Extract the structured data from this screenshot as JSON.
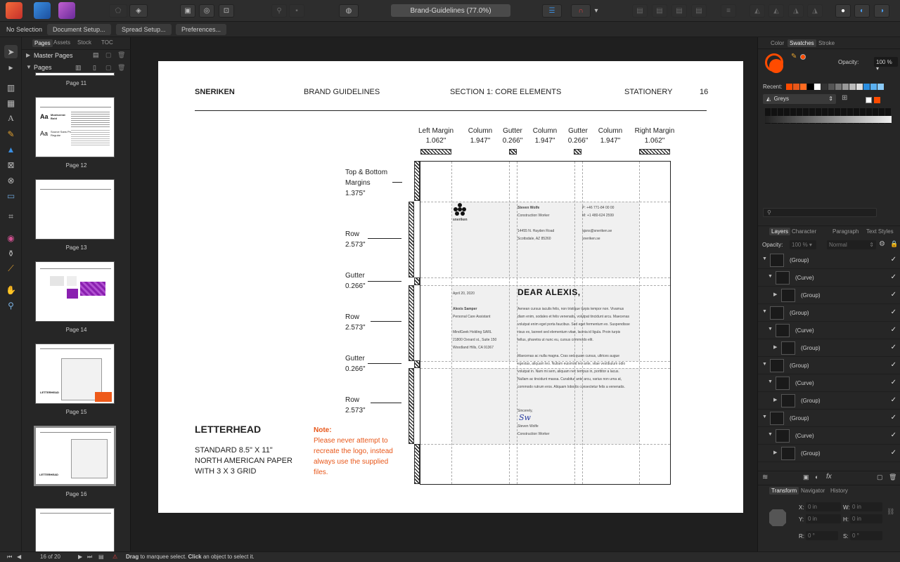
{
  "document": {
    "title": "Brand-Guidelines (77.0%)"
  },
  "context": {
    "selection": "No Selection",
    "document_setup": "Document Setup...",
    "spread_setup": "Spread Setup...",
    "preferences": "Preferences..."
  },
  "pages_panel": {
    "tabs": [
      "Pages",
      "Assets",
      "Stock",
      "TOC"
    ],
    "master_pages": "Master Pages",
    "pages": "Pages",
    "thumbnails": [
      "Page 11",
      "Page 12",
      "Page 13",
      "Page 14",
      "Page 15",
      "Page 16"
    ],
    "page12_font1_name": "Montserrat",
    "page12_font1_weight": "Bold",
    "page12_font2_name": "Source Sans Pro",
    "page12_font2_weight": "Regular",
    "page15_title": "LETTERHEAD",
    "page16_title": "LETTERHEAD"
  },
  "status": {
    "page_counter": "16 of 20",
    "hint_drag": "Drag",
    "hint_mid": " to marquee select. ",
    "hint_click": "Click",
    "hint_end": " an object to select it."
  },
  "page_header": {
    "brand": "SNERIKEN",
    "guide": "BRAND GUIDELINES",
    "section": "SECTION 1: CORE ELEMENTS",
    "topic": "STATIONERY",
    "page_no": "16"
  },
  "margins": [
    {
      "name": "Left Margin",
      "value": "1.062\""
    },
    {
      "name": "Column",
      "value": "1.947\""
    },
    {
      "name": "Gutter",
      "value": "0.266\""
    },
    {
      "name": "Column",
      "value": "1.947\""
    },
    {
      "name": "Gutter",
      "value": "0.266\""
    },
    {
      "name": "Column",
      "value": "1.947\""
    },
    {
      "name": "Right Margin",
      "value": "1.062\""
    }
  ],
  "rows": {
    "tb_l1": "Top & Bottom",
    "tb_l2": "Margins",
    "tb_l3": "1.375\"",
    "row1_name": "Row",
    "row1_val": "2.573\"",
    "gut1_name": "Gutter",
    "gut1_val": "0.266\"",
    "row2_name": "Row",
    "row2_val": "2.573\"",
    "gut2_name": "Gutter",
    "gut2_val": "0.266\"",
    "row3_name": "Row",
    "row3_val": "2.573\""
  },
  "letterhead": {
    "title": "LETTERHEAD",
    "desc1": "STANDARD 8.5\" X 11\"",
    "desc2": "NORTH AMERICAN PAPER",
    "desc3": "WITH 3 X 3 GRID",
    "note_label": "Note:",
    "note1": "Please never attempt to",
    "note2": "recreate the logo, instead",
    "note3": "always use the supplied",
    "note4": "files."
  },
  "letter": {
    "logo_word": "sneriken",
    "sender_name": "Steven Wolfe",
    "sender_role": "Construction Worker",
    "sender_addr1": "14455 N. Hayden Road",
    "sender_addr2": "Scottsdale, AZ 85260",
    "phone": "P:  +46 771-84 00 00",
    "mobile": "M: +1 480-624 2599",
    "email": "ajsns@sneriken.se",
    "web": "sneriken.se",
    "date": "April 20, 2020",
    "to_name": "Alexis Samper",
    "to_role": "Personal Care Assistant",
    "to_co": "MindGeek Holding SARL",
    "to_addr1": "21800 Oxnard st., Suite 150",
    "to_addr2": "Woodland Hills, CA 91367",
    "greeting": "DEAR ALEXIS,",
    "p1_1": "Aenean cursus iaculis felis, non tristique turpis tempor non. Vivamus",
    "p1_2": "diam enim, sodales et felis venenatis, volutpat tincidunt arcu. Maecenas",
    "p1_3": "volutpat enim eget porta faucibus. Sed eget fermentum ex. Suspendisse",
    "p1_4": "risus ex, laoreet sed elementum vitae, lacinia id ligula. Proin turpis",
    "p1_5": "tellus, pharetra ut nunc eu, cursus commodo elit.",
    "p2_1": "Maecenas ac nulla magna. Cras sed quam cursus, ultrices augue",
    "p2_2": "egestas, aliquam leo. Nullam euismod leo ante, vitae vestibulum odio",
    "p2_3": "volutpat in. Nam mi sem, aliquam nec tempus in, porttitor a lacus.",
    "p2_4": "Nullam ac tincidunt massa. Curabitur ante arcu, varius non urna at,",
    "p2_5": "commodo rutrum eros. Aliquam lobortis consectetur felis a venenatis.",
    "signoff": "Sincerely,",
    "signature": "Sw",
    "sign_name": "Steven Wolfe",
    "sign_role": "Construction Worker"
  },
  "right_panel": {
    "top_tabs": [
      "Color",
      "Swatches",
      "Stroke"
    ],
    "opacity_label": "Opacity:",
    "opacity_value": "100 %",
    "recent_label": "Recent:",
    "palette": "Greys",
    "layer_tabs": [
      "Layers",
      "Character",
      "Paragraph",
      "Text Styles"
    ],
    "layer_opacity_label": "Opacity:",
    "layer_opacity": "100 %",
    "blend_mode": "Normal",
    "layers": [
      {
        "name": "(Group)",
        "indent": 0
      },
      {
        "name": "(Curve)",
        "indent": 1
      },
      {
        "name": "(Group)",
        "indent": 2
      },
      {
        "name": "(Group)",
        "indent": 0
      },
      {
        "name": "(Curve)",
        "indent": 1
      },
      {
        "name": "(Group)",
        "indent": 2
      },
      {
        "name": "(Group)",
        "indent": 0
      },
      {
        "name": "(Curve)",
        "indent": 1
      },
      {
        "name": "(Group)",
        "indent": 2
      },
      {
        "name": "(Group)",
        "indent": 0
      },
      {
        "name": "(Curve)",
        "indent": 1
      },
      {
        "name": "(Group)",
        "indent": 2
      }
    ],
    "fx_label": "fx",
    "bottom_tabs": [
      "Transform",
      "Navigator",
      "History"
    ],
    "transform": {
      "x_label": "X:",
      "x": "0 in",
      "y_label": "Y:",
      "y": "0 in",
      "w_label": "W:",
      "w": "0 in",
      "h_label": "H:",
      "h": "0 in",
      "r_label": "R:",
      "r": "0 °",
      "s_label": "S:",
      "s": "0 °"
    }
  },
  "colors": {
    "accent": "#ff4b00",
    "note": "#e8571a",
    "panel": "#262626"
  }
}
